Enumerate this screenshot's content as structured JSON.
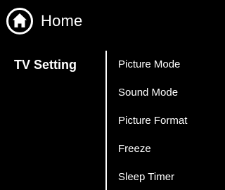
{
  "header": {
    "title": "Home",
    "icon": "home-icon"
  },
  "sidebar": {
    "section_label": "TV Setting"
  },
  "menu": {
    "items": [
      {
        "label": "Picture Mode"
      },
      {
        "label": "Sound Mode"
      },
      {
        "label": "Picture Format"
      },
      {
        "label": "Freeze"
      },
      {
        "label": "Sleep Timer"
      }
    ]
  },
  "colors": {
    "background": "#000000",
    "text": "#ffffff"
  }
}
